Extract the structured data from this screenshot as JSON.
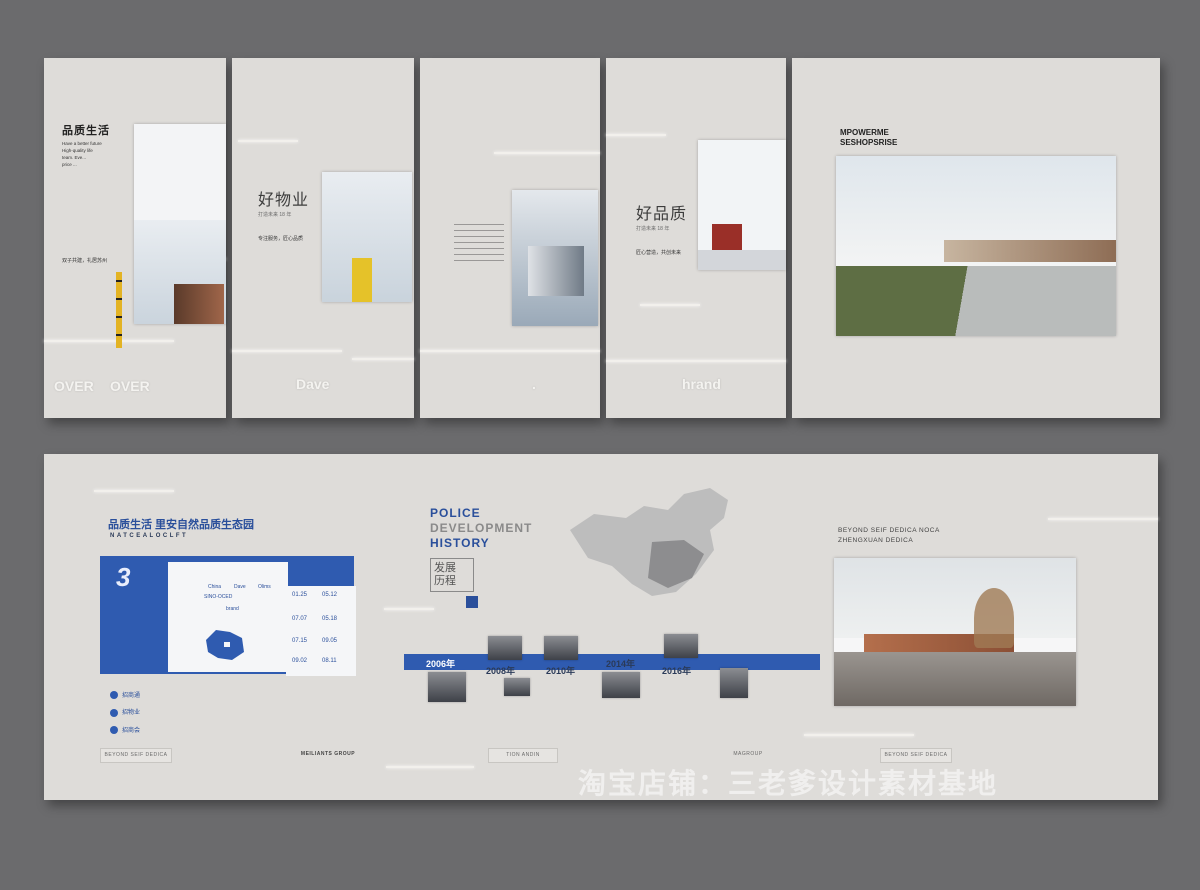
{
  "top_panels": {
    "panel1": {
      "title": "品质生活",
      "intro_lines": [
        "Have a better future",
        "High-quality life",
        "team. Eve...",
        "price ..."
      ],
      "caption": "双子共建，礼居苏州",
      "words": [
        "OVER",
        "OVER"
      ]
    },
    "panel2": {
      "title": "好物业",
      "meta": "打造未来 18 年",
      "caption": "专注服务，匠心品质",
      "word": "Dave"
    },
    "panel3": {
      "word": "."
    },
    "panel4": {
      "title": "好品质",
      "meta": "打造未来 18 年",
      "caption": "匠心营造，共创未来",
      "word": "hrand"
    },
    "panel5": {
      "title_line1": "MPOWERME",
      "title_line2": "SESHOPSRISE"
    }
  },
  "bottom_panel": {
    "left": {
      "headline": "品质生活 里安自然品质生态园",
      "subline": "NATCEALOCLFT",
      "big_number": "3",
      "card_labels": [
        "China",
        "Dave",
        "Olims",
        "SINO-OCED",
        "brand"
      ],
      "dates": [
        "01.25",
        "05.12",
        "07.07",
        "05.18",
        "07.15",
        "09.05",
        "09.02",
        "08.11"
      ],
      "list_items": [
        "招商通",
        "招物业",
        "招商会"
      ]
    },
    "center": {
      "title_line1": "POLICE",
      "title_line2": "DEVELOPMENT",
      "title_line3": "HISTORY",
      "cn_line1": "发展",
      "cn_line2": "历程",
      "timeline_years": [
        "2006年",
        "2008年",
        "2010年",
        "2014年",
        "2016年"
      ]
    },
    "right": {
      "title_line1": "BEYOND SEIF DEDICA NOCA",
      "title_line2": "ZHENGXUAN DEDICA"
    },
    "badges": [
      "BEYOND SEIF DEDICA",
      "MEILIANTS GROUP",
      "TION ANDIN",
      "MAGROUP",
      "BEYOND SEIF DEDICA"
    ]
  },
  "watermark": "淘宝店铺：三老爹设计素材基地",
  "colors": {
    "accent_blue": "#2f5bb0",
    "panel": "#dedcd9",
    "background": "#6b6b6d"
  }
}
